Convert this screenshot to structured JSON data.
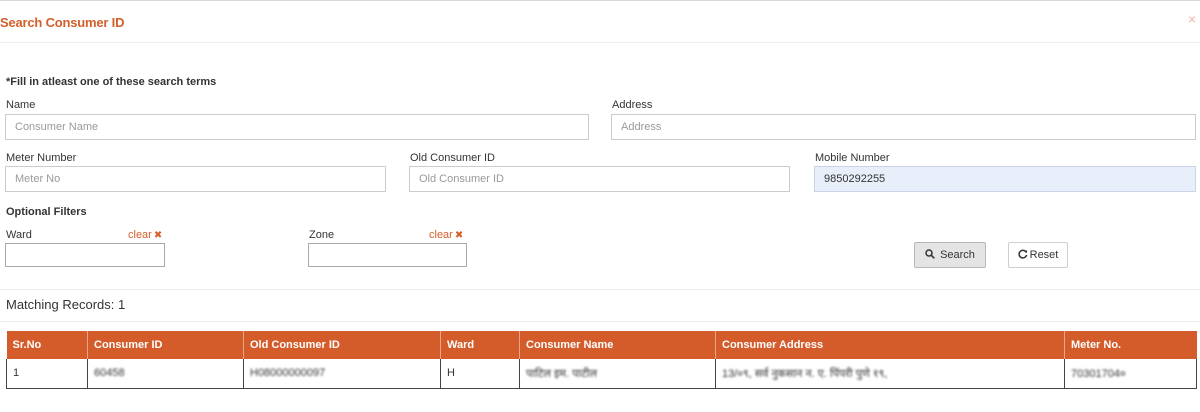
{
  "modal": {
    "title": "Search Consumer ID",
    "close_icon": "close-icon",
    "close_glyph": "×"
  },
  "form": {
    "hint": "*Fill in atleast one of these search terms",
    "name": {
      "label": "Name",
      "placeholder": "Consumer Name",
      "value": ""
    },
    "address": {
      "label": "Address",
      "placeholder": "Address",
      "value": ""
    },
    "meter_number": {
      "label": "Meter Number",
      "placeholder": "Meter No",
      "value": ""
    },
    "old_consumer_id": {
      "label": "Old Consumer ID",
      "placeholder": "Old Consumer ID",
      "value": ""
    },
    "mobile_number": {
      "label": "Mobile Number",
      "placeholder": "",
      "value": "9850292255"
    }
  },
  "filters": {
    "title": "Optional Filters",
    "ward": {
      "label": "Ward",
      "clear_label": "clear",
      "value": ""
    },
    "zone": {
      "label": "Zone",
      "clear_label": "clear",
      "value": ""
    }
  },
  "buttons": {
    "search_label": "Search",
    "search_icon": "search-icon",
    "reset_label": "Reset",
    "reset_icon": "refresh-icon"
  },
  "results": {
    "matching_text": "Matching Records: 1",
    "columns": [
      "Sr.No",
      "Consumer ID",
      "Old Consumer ID",
      "Ward",
      "Consumer Name",
      "Consumer Address",
      "Meter No."
    ],
    "rows": [
      [
        "1",
        "60458",
        "H08000000097",
        "H",
        "पाटिल इम. पाटील",
        "13/०९, सर्व नुकसान न. ए. पिंपरी पुणे १९,",
        "70301704०"
      ]
    ]
  },
  "colors": {
    "accent": "#d35f2a",
    "header_bg": "#d45c2b",
    "filled_input_bg": "#e8effa"
  }
}
